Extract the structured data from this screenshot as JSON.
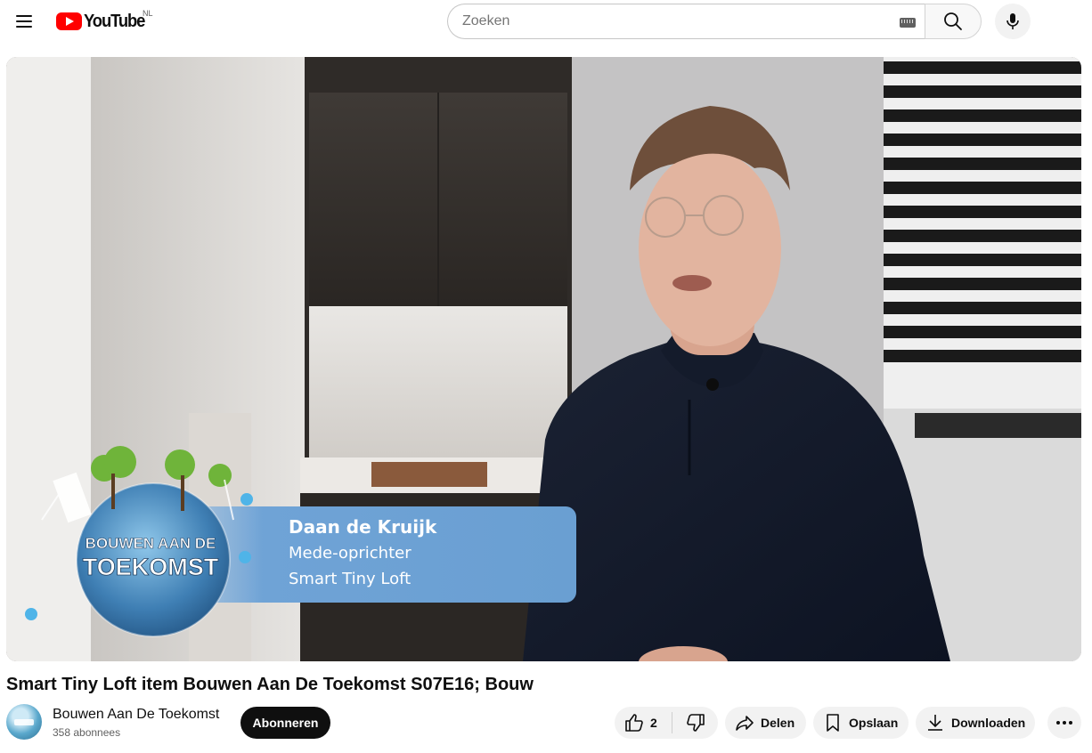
{
  "masthead": {
    "logo_text": "YouTube",
    "country_code": "NL",
    "search_placeholder": "Zoeken",
    "icons": [
      "menu-icon",
      "youtube-logo",
      "keyboard-icon",
      "search-icon",
      "microphone-icon"
    ]
  },
  "player": {
    "overlay": {
      "logo_line1": "BOUWEN AAN DE",
      "logo_line2": "TOEKOMST",
      "lower_third_name": "Daan de Kruijk",
      "lower_third_role": "Mede-oprichter",
      "lower_third_company": "Smart Tiny Loft"
    }
  },
  "video": {
    "title": "Smart Tiny Loft item Bouwen Aan De Toekomst S07E16; Bouw"
  },
  "channel": {
    "name": "Bouwen Aan De Toekomst",
    "subscribers": "358 abonnees",
    "subscribe_label": "Abonneren"
  },
  "actions": {
    "like_count": "2",
    "share_label": "Delen",
    "save_label": "Opslaan",
    "download_label": "Downloaden",
    "icons": [
      "thumbs-up-icon",
      "thumbs-down-icon",
      "share-icon",
      "bookmark-icon",
      "download-icon",
      "more-icon"
    ]
  },
  "colors": {
    "brand_red": "#ff0000",
    "text_primary": "#0f0f0f",
    "text_secondary": "#606060",
    "pill_bg": "#f2f2f2",
    "lower_third_blue": "#6fa3d6"
  }
}
